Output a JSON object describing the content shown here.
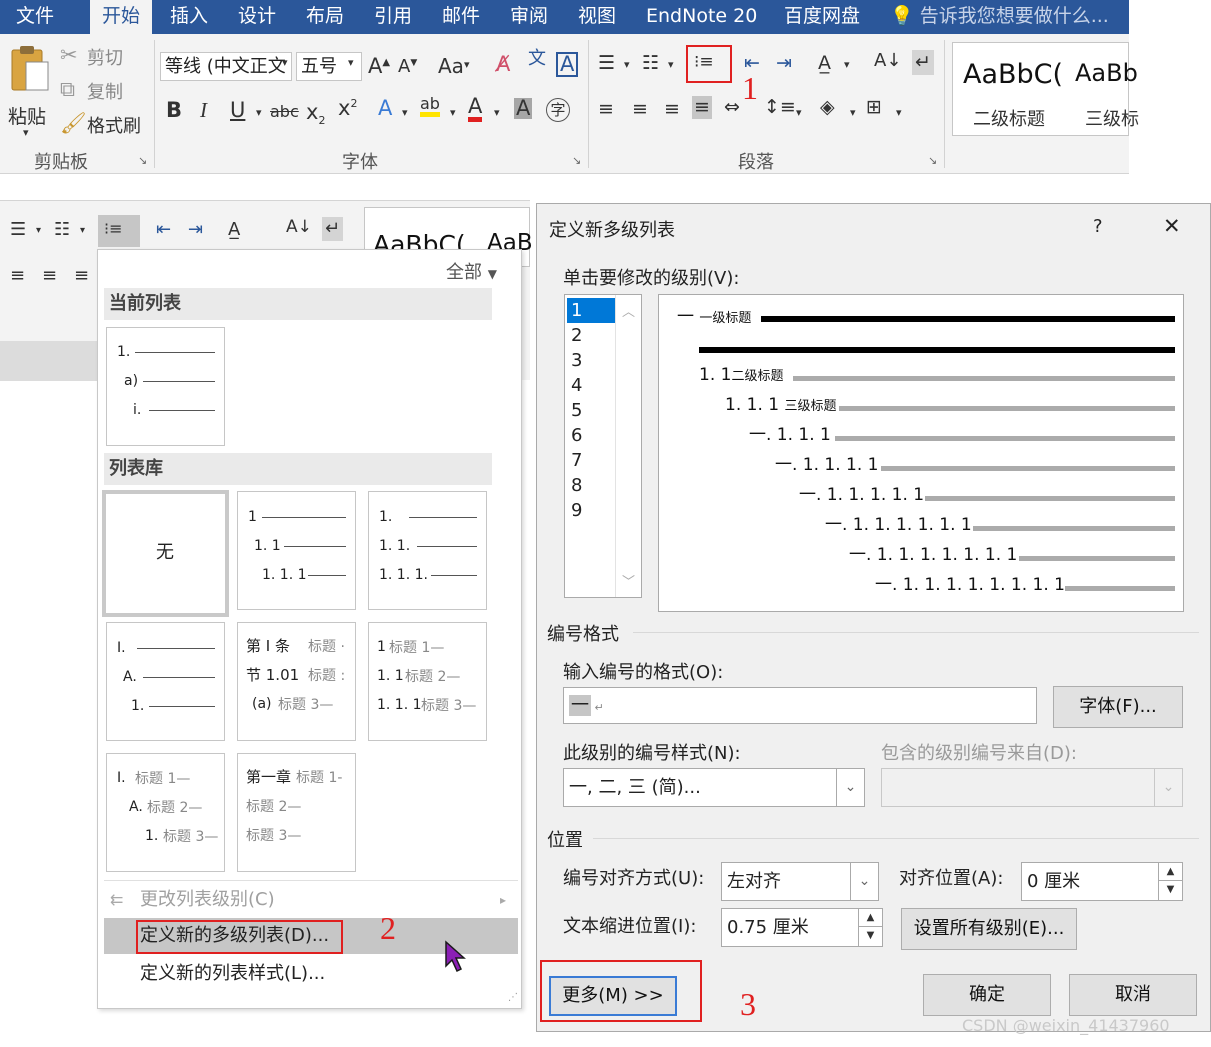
{
  "ribbon": {
    "tabs": [
      "文件",
      "开始",
      "插入",
      "设计",
      "布局",
      "引用",
      "邮件",
      "审阅",
      "视图",
      "EndNote 20",
      "百度网盘"
    ],
    "active_tab": "开始",
    "tell_me": "告诉我您想要做什么...",
    "clipboard": {
      "paste": "粘贴",
      "cut": "剪切",
      "copy": "复制",
      "format_painter": "格式刷",
      "group": "剪贴板"
    },
    "font": {
      "font_name": "等线 (中文正文",
      "font_size": "五号",
      "aa": "Aa",
      "group": "字体"
    },
    "paragraph": {
      "group": "段落"
    },
    "styles": {
      "sample1": "AaBbC(",
      "sample2": "AaBb",
      "name1": "二级标题",
      "name2": "三级标"
    }
  },
  "mini_ribbon": {
    "styles_sample1": "AaBbC(",
    "styles_sample2": "AaB"
  },
  "annotations": {
    "a1": "1",
    "a2": "2",
    "a3": "3"
  },
  "dropdown": {
    "filter": "全部",
    "current_list_header": "当前列表",
    "library_header": "列表库",
    "current_list": [
      "1.",
      "a)",
      "i."
    ],
    "none_label": "无",
    "lib1": [
      "1",
      "1. 1",
      "1. 1. 1"
    ],
    "lib2": [
      "1.",
      "1. 1.",
      "1. 1. 1."
    ],
    "lib3": [
      "I.",
      "A.",
      "1."
    ],
    "lib4": {
      "l1a": "第 I 条",
      "l1b": "标题 ·",
      "l2a": "节 1.01",
      "l2b": "标题 :",
      "l3a": "(a)",
      "l3b": "标题 3—"
    },
    "lib5": {
      "l1a": "1",
      "l1b": "标题 1—",
      "l2a": "1. 1",
      "l2b": "标题 2—",
      "l3a": "1. 1. 1",
      "l3b": "标题 3—"
    },
    "lib6": {
      "l1a": "I.",
      "l1b": "标题 1—",
      "l2a": "A.",
      "l2b": "标题 2—",
      "l3a": "1.",
      "l3b": "标题 3—"
    },
    "lib7": {
      "l1a": "第一章",
      "l1b": "标题 1-",
      "l2": "标题 2—",
      "l3": "标题 3—"
    },
    "change_level": "更改列表级别(C)",
    "define_multilevel": "定义新的多级列表(D)...",
    "define_style": "定义新的列表样式(L)..."
  },
  "dialog": {
    "title": "定义新多级列表",
    "help": "?",
    "close": "✕",
    "level_label": "单击要修改的级别(V):",
    "levels": [
      "1",
      "2",
      "3",
      "4",
      "5",
      "6",
      "7",
      "8",
      "9"
    ],
    "preview": {
      "l1": "一",
      "l1_style": "一级标题",
      "l2": "1. 1",
      "l2_style": "二级标题",
      "l3": "1. 1. 1",
      "l3_style": "三级标题",
      "l4": "一. 1. 1. 1",
      "l5": "一. 1. 1. 1. 1",
      "l6": "一. 1. 1. 1. 1. 1",
      "l7": "一. 1. 1. 1. 1. 1. 1",
      "l8": "一. 1. 1. 1. 1. 1. 1. 1",
      "l9": "一. 1. 1. 1. 1. 1. 1. 1. 1"
    },
    "numbering_format_section": "编号格式",
    "format_input_label": "输入编号的格式(O):",
    "format_input_value": "一",
    "font_button": "字体(F)...",
    "number_style_label": "此级别的编号样式(N):",
    "number_style_value": "一, 二, 三 (简)...",
    "include_level_label": "包含的级别编号来自(D):",
    "position_section": "位置",
    "alignment_label": "编号对齐方式(U):",
    "alignment_value": "左对齐",
    "align_at_label": "对齐位置(A):",
    "align_at_value": "0 厘米",
    "indent_label": "文本缩进位置(I):",
    "indent_value": "0.75 厘米",
    "set_all_levels": "设置所有级别(E)...",
    "more_button": "更多(M) >>",
    "ok": "确定",
    "cancel": "取消"
  },
  "watermark": "CSDN @weixin_41437960",
  "colors": {
    "tab_bar": "#2b579a",
    "highlight_red": "#e02020",
    "selection_blue": "#0078d7"
  }
}
